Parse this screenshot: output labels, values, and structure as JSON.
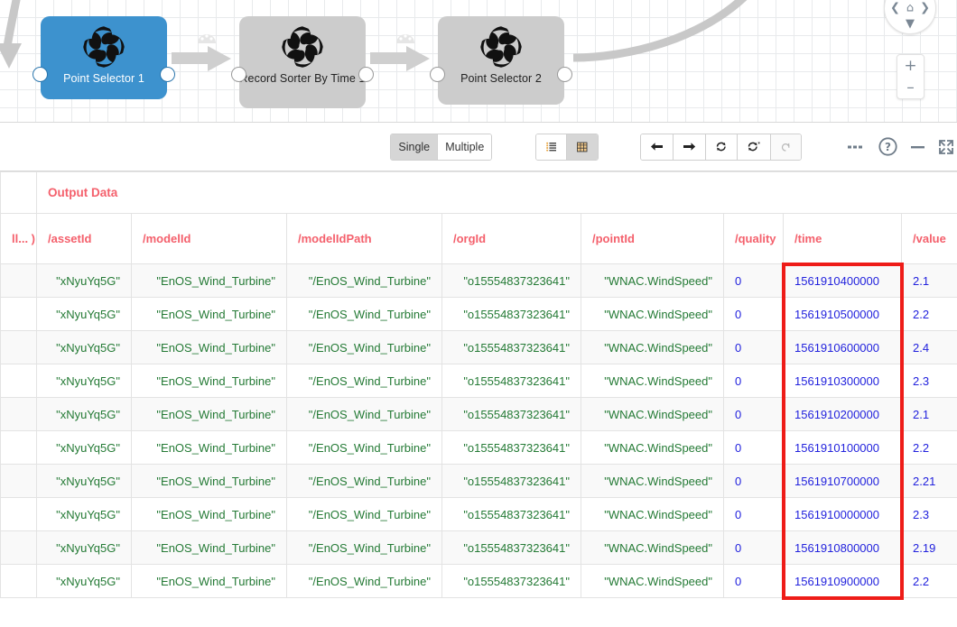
{
  "canvas": {
    "nodes": [
      {
        "label": "Point Selector 1",
        "state": "selected"
      },
      {
        "label": "Record Sorter By Time 1",
        "state": "normal"
      },
      {
        "label": "Point Selector 2",
        "state": "normal"
      }
    ],
    "nav": {
      "up_icon": "chevron-up-icon",
      "down_icon": "chevron-down-icon",
      "left_icon": "chevron-left-icon",
      "right_icon": "chevron-right-icon",
      "home_icon": "home-icon",
      "zoom_in_label": "+",
      "zoom_out_label": "–"
    }
  },
  "toolbar": {
    "mode_single": "Single",
    "mode_multiple": "Multiple",
    "mode_selected": "Single",
    "view_list_icon": "list-view-icon",
    "view_grid_icon": "grid-view-icon",
    "view_selected": "grid",
    "prev_icon": "arrow-left-icon",
    "next_icon": "arrow-right-icon",
    "refresh_icon": "refresh-icon",
    "refresh_all_icon": "refresh-asterisk-icon",
    "reset_icon": "undo-icon",
    "more_icon": "ellipsis-icon",
    "help_icon": "help-circle-icon",
    "minimize_icon": "minimize-icon",
    "fullscreen_icon": "fullscreen-icon"
  },
  "table": {
    "group_header": "Output Data",
    "rowhead_label": "ll... )",
    "columns": [
      "/assetId",
      "/modelId",
      "/modelIdPath",
      "/orgId",
      "/pointId",
      "/quality",
      "/time",
      "/value"
    ],
    "rows": [
      {
        "assetId": "\"xNyuYq5G\"",
        "modelId": "\"EnOS_Wind_Turbine\"",
        "modelIdPath": "\"/EnOS_Wind_Turbine\"",
        "orgId": "\"o15554837323641\"",
        "pointId": "\"WNAC.WindSpeed\"",
        "quality": "0",
        "time": "1561910400000",
        "value": "2.1"
      },
      {
        "assetId": "\"xNyuYq5G\"",
        "modelId": "\"EnOS_Wind_Turbine\"",
        "modelIdPath": "\"/EnOS_Wind_Turbine\"",
        "orgId": "\"o15554837323641\"",
        "pointId": "\"WNAC.WindSpeed\"",
        "quality": "0",
        "time": "1561910500000",
        "value": "2.2"
      },
      {
        "assetId": "\"xNyuYq5G\"",
        "modelId": "\"EnOS_Wind_Turbine\"",
        "modelIdPath": "\"/EnOS_Wind_Turbine\"",
        "orgId": "\"o15554837323641\"",
        "pointId": "\"WNAC.WindSpeed\"",
        "quality": "0",
        "time": "1561910600000",
        "value": "2.4"
      },
      {
        "assetId": "\"xNyuYq5G\"",
        "modelId": "\"EnOS_Wind_Turbine\"",
        "modelIdPath": "\"/EnOS_Wind_Turbine\"",
        "orgId": "\"o15554837323641\"",
        "pointId": "\"WNAC.WindSpeed\"",
        "quality": "0",
        "time": "1561910300000",
        "value": "2.3"
      },
      {
        "assetId": "\"xNyuYq5G\"",
        "modelId": "\"EnOS_Wind_Turbine\"",
        "modelIdPath": "\"/EnOS_Wind_Turbine\"",
        "orgId": "\"o15554837323641\"",
        "pointId": "\"WNAC.WindSpeed\"",
        "quality": "0",
        "time": "1561910200000",
        "value": "2.1"
      },
      {
        "assetId": "\"xNyuYq5G\"",
        "modelId": "\"EnOS_Wind_Turbine\"",
        "modelIdPath": "\"/EnOS_Wind_Turbine\"",
        "orgId": "\"o15554837323641\"",
        "pointId": "\"WNAC.WindSpeed\"",
        "quality": "0",
        "time": "1561910100000",
        "value": "2.2"
      },
      {
        "assetId": "\"xNyuYq5G\"",
        "modelId": "\"EnOS_Wind_Turbine\"",
        "modelIdPath": "\"/EnOS_Wind_Turbine\"",
        "orgId": "\"o15554837323641\"",
        "pointId": "\"WNAC.WindSpeed\"",
        "quality": "0",
        "time": "1561910700000",
        "value": "2.21"
      },
      {
        "assetId": "\"xNyuYq5G\"",
        "modelId": "\"EnOS_Wind_Turbine\"",
        "modelIdPath": "\"/EnOS_Wind_Turbine\"",
        "orgId": "\"o15554837323641\"",
        "pointId": "\"WNAC.WindSpeed\"",
        "quality": "0",
        "time": "1561910000000",
        "value": "2.3"
      },
      {
        "assetId": "\"xNyuYq5G\"",
        "modelId": "\"EnOS_Wind_Turbine\"",
        "modelIdPath": "\"/EnOS_Wind_Turbine\"",
        "orgId": "\"o15554837323641\"",
        "pointId": "\"WNAC.WindSpeed\"",
        "quality": "0",
        "time": "1561910800000",
        "value": "2.19"
      },
      {
        "assetId": "\"xNyuYq5G\"",
        "modelId": "\"EnOS_Wind_Turbine\"",
        "modelIdPath": "\"/EnOS_Wind_Turbine\"",
        "orgId": "\"o15554837323641\"",
        "pointId": "\"WNAC.WindSpeed\"",
        "quality": "0",
        "time": "1561910900000",
        "value": "2.2"
      }
    ],
    "highlight": {
      "column": "/time",
      "color": "#ee1c18"
    }
  },
  "colors": {
    "node_selected": "#3d92ce",
    "node_normal": "#cccccc",
    "header_text": "#f4606c",
    "string_value": "#247a35",
    "number_value": "#2222dd",
    "highlight": "#ee1c18"
  }
}
